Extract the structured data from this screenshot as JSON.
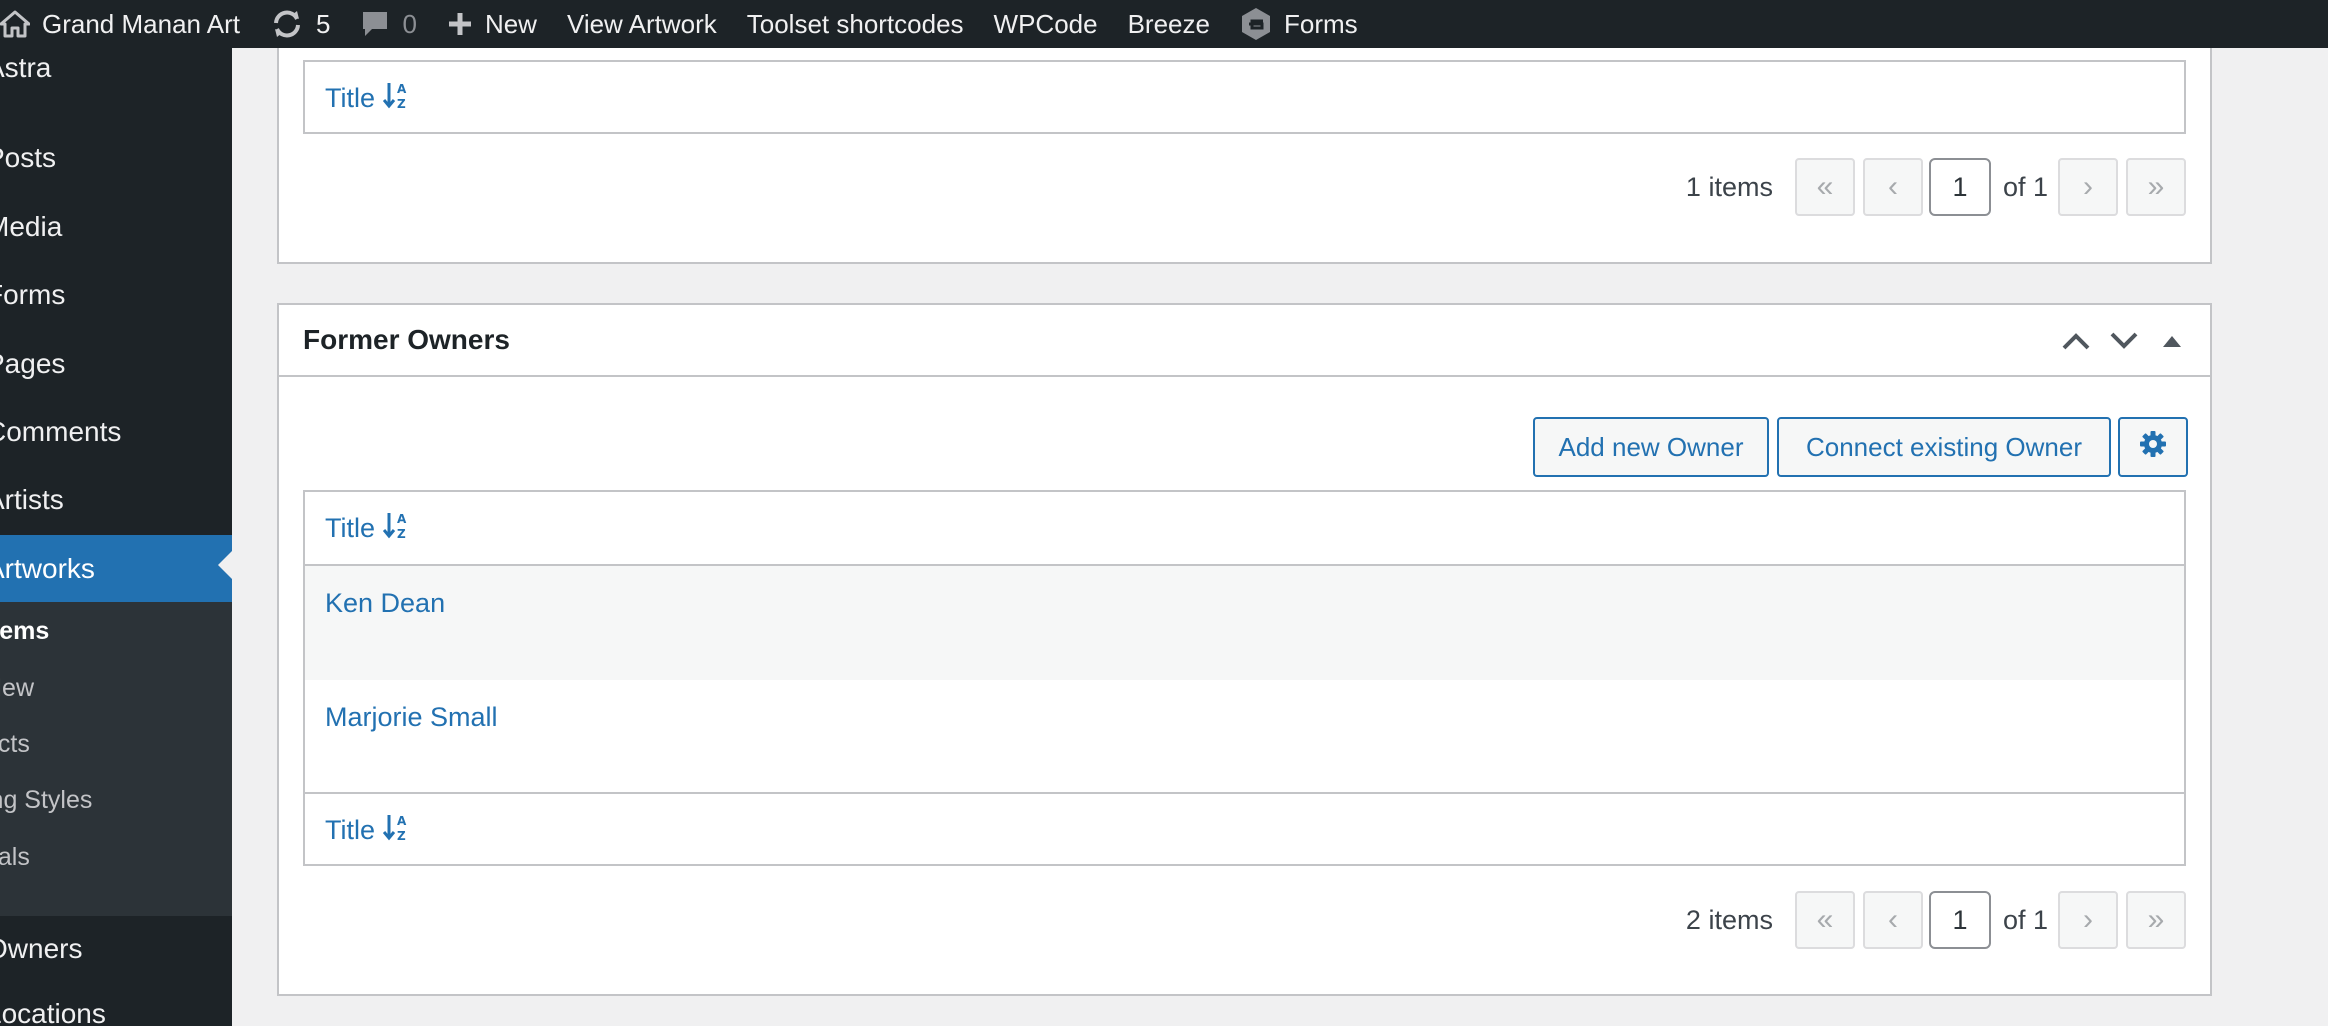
{
  "adminbar": {
    "site_name": "Grand Manan Art",
    "updates_count": "5",
    "comments_count": "0",
    "new_label": "New",
    "view_label": "View Artwork",
    "toolset_label": "Toolset shortcodes",
    "wpcode_label": "WPCode",
    "breeze_label": "Breeze",
    "forms_label": "Forms"
  },
  "sidebar": {
    "items": [
      {
        "label": "Astra"
      },
      {
        "label": "Posts"
      },
      {
        "label": "Media"
      },
      {
        "label": "Forms"
      },
      {
        "label": "Pages"
      },
      {
        "label": "Comments"
      },
      {
        "label": "Artists"
      },
      {
        "label": "Artworks"
      },
      {
        "label": "Owners"
      },
      {
        "label": "Locations"
      }
    ],
    "submenu": [
      {
        "label": "Items"
      },
      {
        "label": "New"
      },
      {
        "label": "ects"
      },
      {
        "label": "ing Styles"
      },
      {
        "label": "rials"
      }
    ]
  },
  "top_box": {
    "column_title": "Title",
    "items_count": "1 items",
    "page_current": "1",
    "page_of": "of 1"
  },
  "former_owners": {
    "title": "Former Owners",
    "add_button": "Add new Owner",
    "connect_button": "Connect existing Owner",
    "column_title": "Title",
    "rows": [
      {
        "name": "Ken Dean"
      },
      {
        "name": "Marjorie Small"
      }
    ],
    "footer_title": "Title",
    "items_count": "2 items",
    "page_current": "1",
    "page_of": "of 1"
  },
  "pager_glyphs": {
    "first": "«",
    "prev": "‹",
    "next": "›",
    "last": "»"
  },
  "colors": {
    "accent": "#2271b1",
    "adminbar_bg": "#1d2327",
    "page_bg": "#f0f0f1"
  }
}
